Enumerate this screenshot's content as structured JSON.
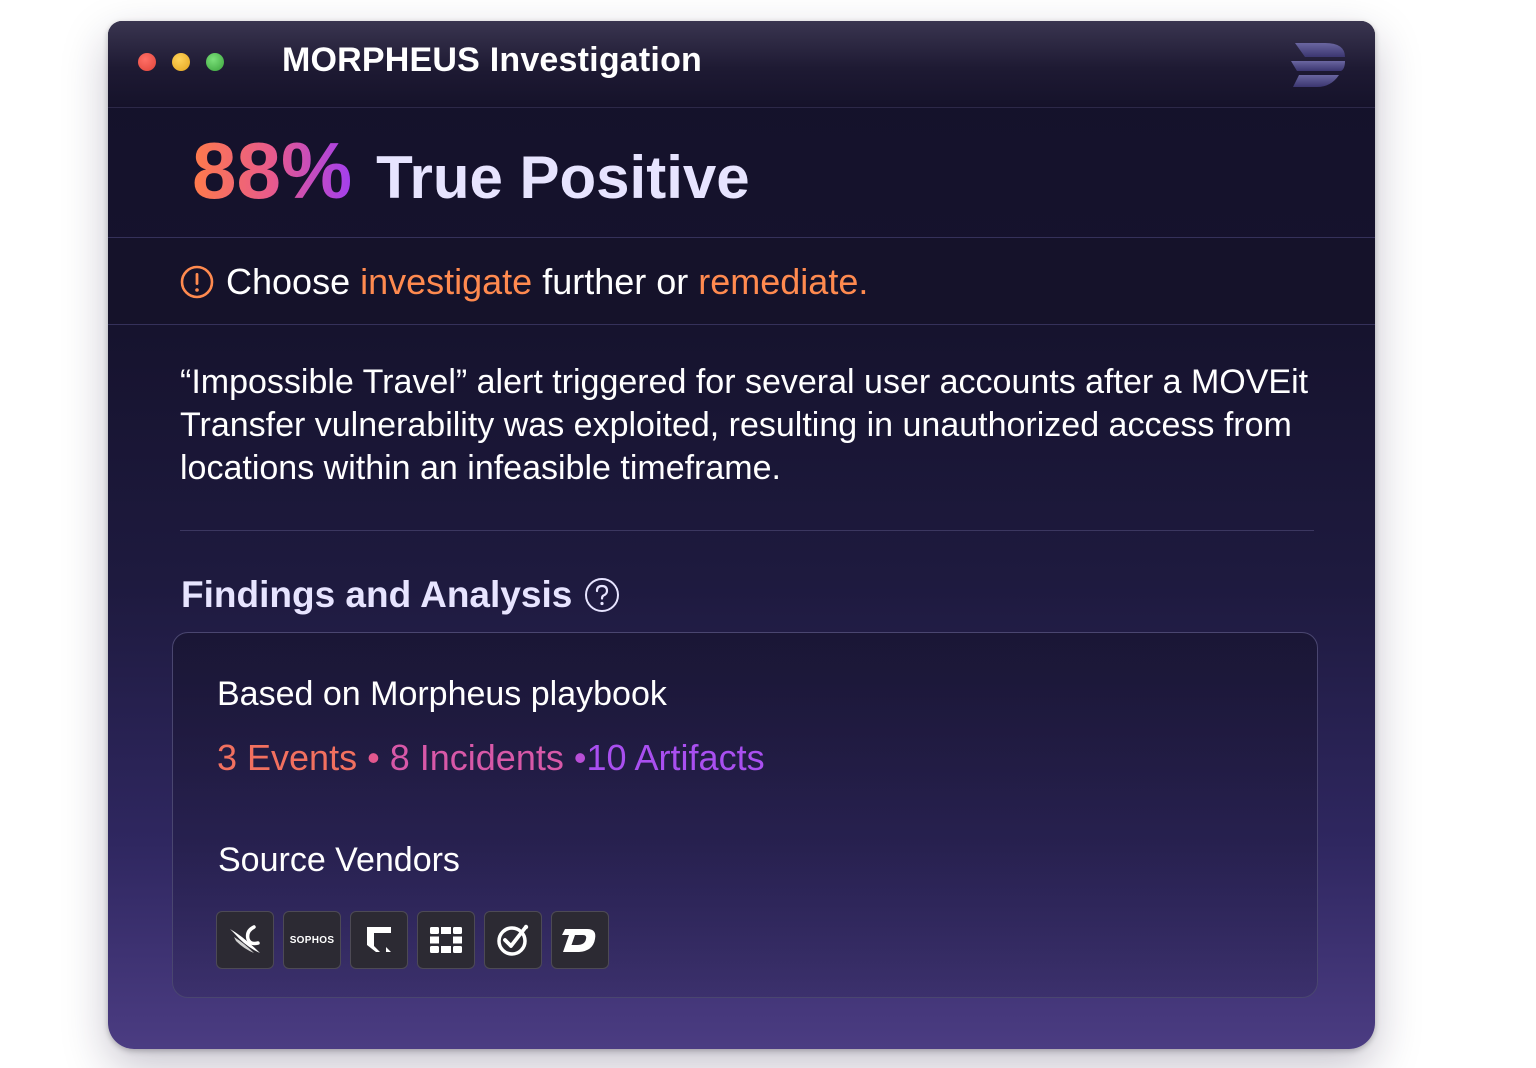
{
  "window": {
    "title": "MORPHEUS Investigation",
    "controls": [
      "close",
      "minimize",
      "maximize"
    ]
  },
  "brand": {
    "logo_icon": "morpheus-logo-icon"
  },
  "verdict": {
    "percentage": "88%",
    "label": "True Positive"
  },
  "callout": {
    "icon": "alert-circle-icon",
    "prefix": "Choose ",
    "action1": "investigate",
    "middle": " further or ",
    "action2": "remediate."
  },
  "summary": "“Impossible Travel” alert triggered for several user accounts after a MOVEit Transfer vulnerability was exploited, resulting in unauthorized access from locations within an infeasible timeframe.",
  "findings": {
    "title": "Findings and Analysis",
    "help_icon": "help-circle-icon",
    "playbook": "Based on Morpheus playbook",
    "events": "3 Events",
    "separator": "•",
    "incidents": "8 Incidents",
    "artifacts": "10 Artifacts",
    "vendors_label": "Source Vendors",
    "vendors": [
      {
        "icon": "crowdstrike-icon"
      },
      {
        "icon": "sophos-icon",
        "text": "SOPHOS"
      },
      {
        "icon": "paloalto-icon"
      },
      {
        "icon": "fortinet-icon"
      },
      {
        "icon": "checkmark-target-icon"
      },
      {
        "icon": "lightning-d-icon"
      }
    ]
  },
  "colors": {
    "accent_orange": "#ff8a4f",
    "events": "#f2705f",
    "incidents": "#d858a8",
    "artifacts": "#a94ff0"
  }
}
